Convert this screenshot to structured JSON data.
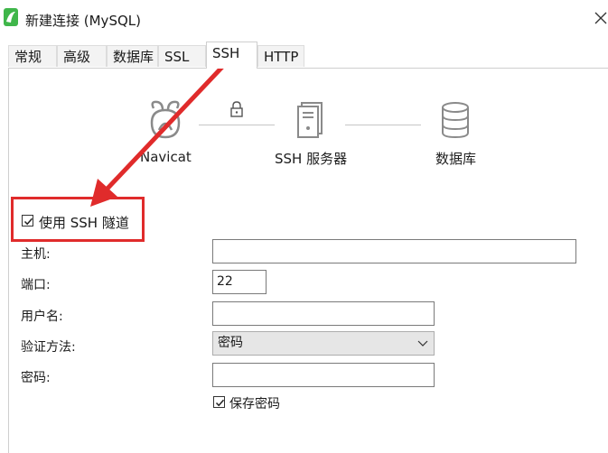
{
  "window": {
    "title": "新建连接 (MySQL)"
  },
  "tabs": [
    "常规",
    "高级",
    "数据库",
    "SSL",
    "SSH",
    "HTTP"
  ],
  "active_tab": "SSH",
  "diagram": {
    "client_label": "Navicat",
    "server_label": "SSH 服务器",
    "db_label": "数据库"
  },
  "ssh": {
    "use_tunnel_label": "使用 SSH 隧道",
    "use_tunnel_checked": true,
    "host_label": "主机:",
    "host_value": "",
    "port_label": "端口:",
    "port_value": "22",
    "user_label": "用户名:",
    "user_value": "",
    "auth_label": "验证方法:",
    "auth_value": "密码",
    "password_label": "密码:",
    "password_value": "",
    "save_password_label": "保存密码",
    "save_password_checked": true
  },
  "colors": {
    "annotation": "#e02b2b",
    "app_icon": "#3fb64a"
  }
}
